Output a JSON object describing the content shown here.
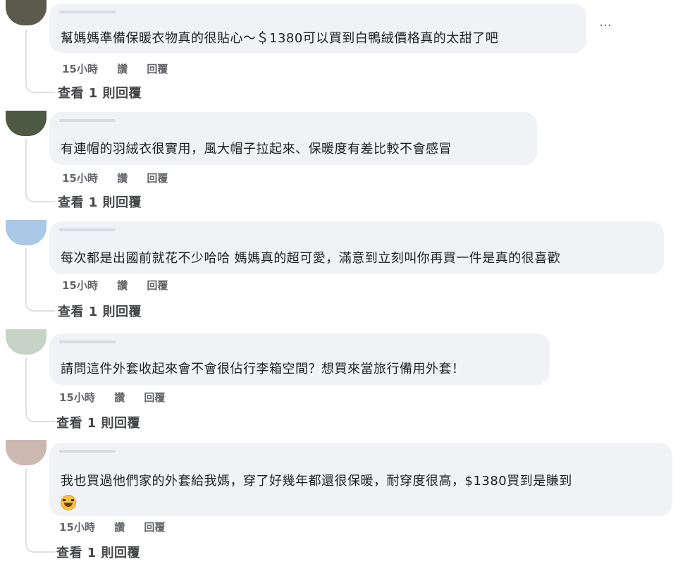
{
  "colors": {
    "bubble_bg": "#f0f2f5",
    "meta_text": "#65676b",
    "connector": "#dcdfe4",
    "avatar_1": "#5b5a4d",
    "avatar_2": "#4d5a43",
    "avatar_3": "#a8c8e6",
    "avatar_4": "#c8d3c8",
    "avatar_5": "#cbb8b0"
  },
  "more_icon": "ellipsis-icon",
  "comments": [
    {
      "text": "幫媽媽準備保暖衣物真的很貼心～＄1380可以買到白鴨絨價格真的太甜了吧",
      "time": "15小時",
      "like": "讚",
      "reply": "回覆",
      "view_replies": "查看 1 則回覆"
    },
    {
      "text": "有連帽的羽絨衣很實用，風大帽子拉起來、保暖度有差比較不會感冒",
      "time": "15小時",
      "like": "讚",
      "reply": "回覆",
      "view_replies": "查看 1 則回覆"
    },
    {
      "text": "每次都是出國前就花不少哈哈 媽媽真的超可愛，滿意到立刻叫你再買一件是真的很喜歡",
      "time": "15小時",
      "like": "讚",
      "reply": "回覆",
      "view_replies": "查看 1 則回覆"
    },
    {
      "text": "請問這件外套收起來會不會很佔行李箱空間？想買來當旅行備用外套！",
      "time": "15小時",
      "like": "讚",
      "reply": "回覆",
      "view_replies": "查看 1 則回覆"
    },
    {
      "text": "我也買過他們家的外套給我媽，穿了好幾年都還很保暖，耐穿度很高，$1380買到是賺到",
      "emoji": "rolling-laughing-emoji",
      "time": "15小時",
      "like": "讚",
      "reply": "回覆",
      "view_replies": "查看 1 則回覆"
    }
  ]
}
